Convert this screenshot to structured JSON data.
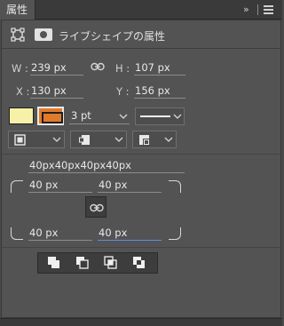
{
  "tabbar": {
    "tab_label": "属性",
    "expand_glyph": "»",
    "menu_icon": "hamburger-menu-icon"
  },
  "header": {
    "title": "ライブシェイプの属性",
    "shape_icon": "transform-bounding-box-icon",
    "mask_icon": "mask-icon"
  },
  "transform": {
    "w_label": "W :",
    "w_value": "239 px",
    "h_label": "H :",
    "h_value": "107 px",
    "x_label": "X :",
    "x_value": "130 px",
    "y_label": "Y :",
    "y_value": "156 px",
    "link_icon": "link-icon"
  },
  "appearance": {
    "fill_color": "#f7f0a8",
    "stroke_color": "#e27a2c",
    "stroke_width": "3 pt",
    "stroke_style": "solid-line"
  },
  "corners": {
    "all_value": "40px40px40px40px",
    "top_left": "40 px",
    "top_right": "40 px",
    "bottom_left": "40 px",
    "bottom_right": "40 px",
    "link_icon": "chain-link-icon"
  },
  "path_ops": [
    "combine-shapes-icon",
    "subtract-front-shape-icon",
    "intersect-shape-areas-icon",
    "exclude-overlapping-shapes-icon"
  ],
  "colors": {
    "panel": "#535353",
    "accent": "#5b8cde"
  }
}
